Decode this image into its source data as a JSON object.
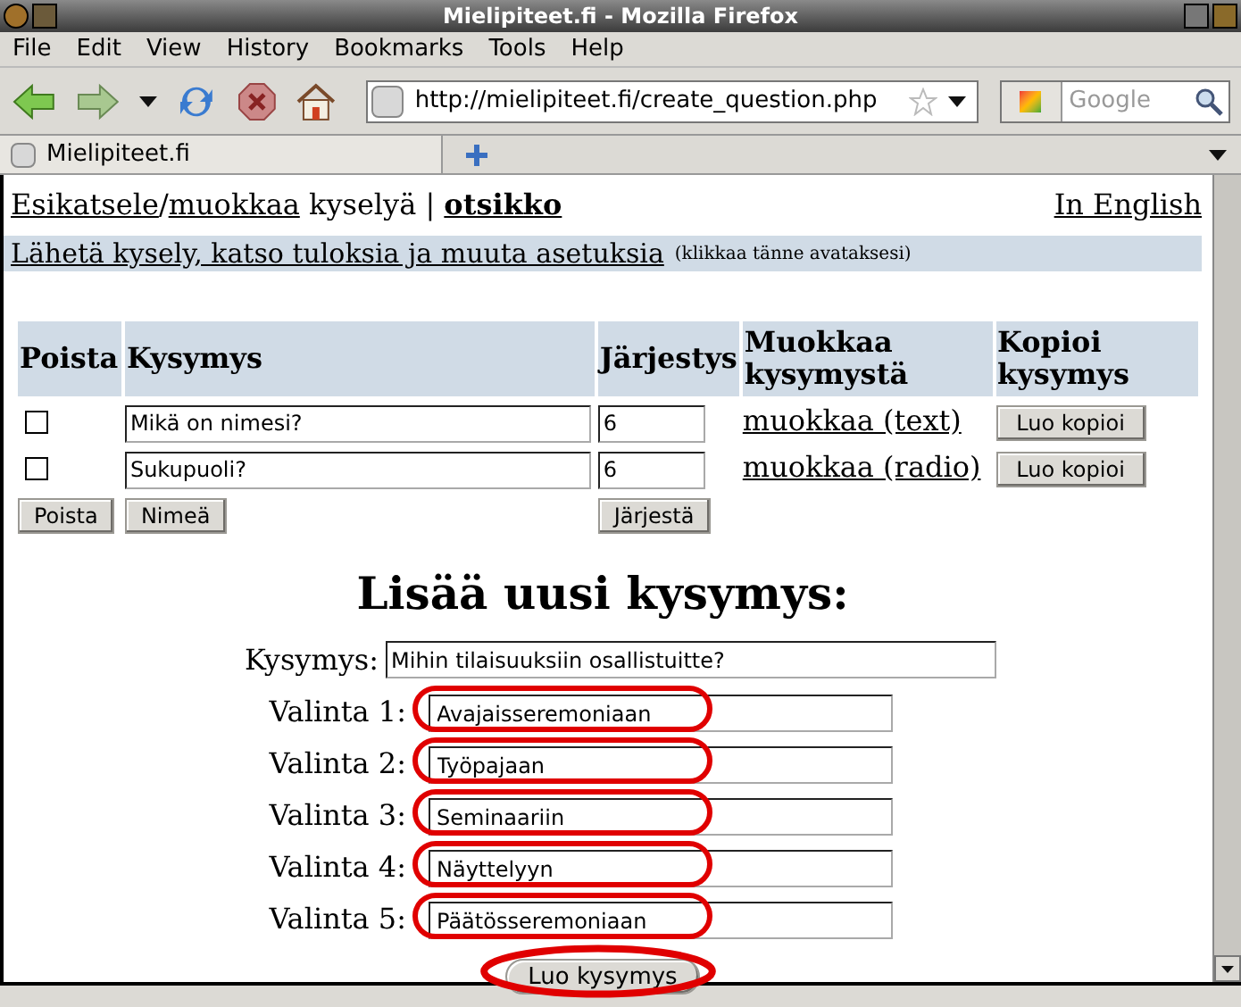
{
  "window": {
    "title": "Mielipiteet.fi - Mozilla Firefox"
  },
  "menu": [
    {
      "label": "File"
    },
    {
      "label": "Edit"
    },
    {
      "label": "View"
    },
    {
      "label": "History"
    },
    {
      "label": "Bookmarks"
    },
    {
      "label": "Tools"
    },
    {
      "label": "Help"
    }
  ],
  "toolbar": {
    "url": "http://mielipiteet.fi/create_question.php",
    "search_placeholder": "Google"
  },
  "tabs": [
    {
      "label": "Mielipiteet.fi",
      "selected": true
    }
  ],
  "page": {
    "breadcrumb": {
      "link1": "Esikatsele",
      "sep": "/",
      "link2": "muokkaa",
      "text": " kyselyä | ",
      "title": "otsikko"
    },
    "language_link": "In English",
    "settings_bar": {
      "link": "Lähetä kysely, katso tuloksia ja muuta asetuksia",
      "hint": "(klikkaa tänne avataksesi)"
    },
    "table": {
      "columns": [
        "Poista",
        "Kysymys",
        "Järjestys",
        "Muokkaa kysymystä",
        "Kopioi kysymys"
      ],
      "rows": [
        {
          "checked": false,
          "question": "Mikä on nimesi?",
          "order": "6",
          "edit_link": "muokkaa (text)",
          "copy_button": "Luo kopioi"
        },
        {
          "checked": false,
          "question": "Sukupuoli?",
          "order": "6",
          "edit_link": "muokkaa (radio)",
          "copy_button": "Luo kopioi"
        }
      ],
      "buttons": [
        "Poista",
        "Nimeä",
        "Järjestä"
      ]
    },
    "new_question": {
      "heading": "Lisää uusi kysymys:",
      "question_label": "Kysymys:",
      "question_value": "Mihin tilaisuuksiin osallistuitte?",
      "options": [
        {
          "label": "Valinta 1:",
          "value": "Avajaisseremoniaan",
          "highlighted": true
        },
        {
          "label": "Valinta 2:",
          "value": "Työpajaan",
          "highlighted": true
        },
        {
          "label": "Valinta 3:",
          "value": "Seminaariin",
          "highlighted": true
        },
        {
          "label": "Valinta 4:",
          "value": "Näyttelyyn",
          "highlighted": true
        },
        {
          "label": "Valinta 5:",
          "value": "Päätösseremoniaan",
          "highlighted": true
        }
      ],
      "submit": {
        "label": "Luo kysymys",
        "highlighted": true
      }
    }
  }
}
